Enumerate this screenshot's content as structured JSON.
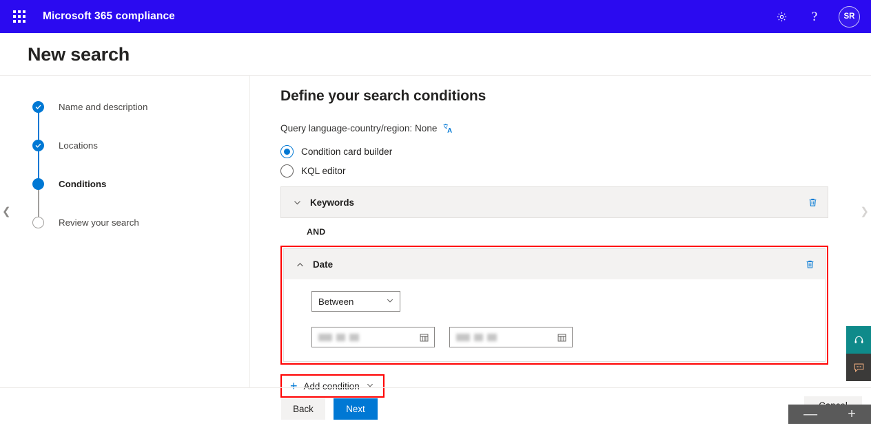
{
  "suite": {
    "waffle_icon": "app-launcher-waffle-icon",
    "title": "Microsoft 365 compliance",
    "settings_icon": "gear-icon",
    "help_icon": "question-mark-icon",
    "avatar_initials": "SR",
    "brand_color": "#2B0AF0"
  },
  "page": {
    "title": "New search",
    "collapse_left_icon": "chevron-left-icon",
    "collapse_right_icon": "chevron-right-icon"
  },
  "wizard": {
    "steps": [
      {
        "label": "Name and description",
        "state": "done"
      },
      {
        "label": "Locations",
        "state": "done"
      },
      {
        "label": "Conditions",
        "state": "current"
      },
      {
        "label": "Review your search",
        "state": "todo"
      }
    ]
  },
  "main": {
    "heading": "Define your search conditions",
    "query_language_label": "Query language-country/region: None",
    "translate_icon": "translate-icon",
    "builder_modes": [
      {
        "label": "Condition card builder",
        "selected": true
      },
      {
        "label": "KQL editor",
        "selected": false
      }
    ],
    "conditions": [
      {
        "title": "Keywords",
        "expanded": false,
        "toggle_icon": "chevron-down-icon",
        "delete_icon": "trash-icon"
      },
      {
        "title": "Date",
        "expanded": true,
        "toggle_icon": "chevron-up-icon",
        "delete_icon": "trash-icon",
        "highlighted": true,
        "operator": {
          "value": "Between",
          "chevron_icon": "chevron-down-icon"
        },
        "date_fields": [
          {
            "value": "",
            "redacted": true,
            "calendar_icon": "calendar-icon"
          },
          {
            "value": "",
            "redacted": true,
            "calendar_icon": "calendar-icon"
          }
        ]
      }
    ],
    "operator_between_cards": "AND",
    "add_condition": {
      "label": "Add condition",
      "plus_icon": "plus-icon",
      "chevron_icon": "chevron-down-icon",
      "highlighted": true
    }
  },
  "footer": {
    "back_label": "Back",
    "next_label": "Next",
    "cancel_label": "Cancel"
  },
  "widgets": {
    "support_icon": "headset-icon",
    "feedback_icon": "chat-bubble-icon",
    "support_color": "#0f8a8a",
    "feedback_color": "#3b3a39"
  },
  "zoom_control": {
    "zoom_out_label": "—",
    "zoom_in_label": "+"
  },
  "highlight_color": "#ff0000"
}
